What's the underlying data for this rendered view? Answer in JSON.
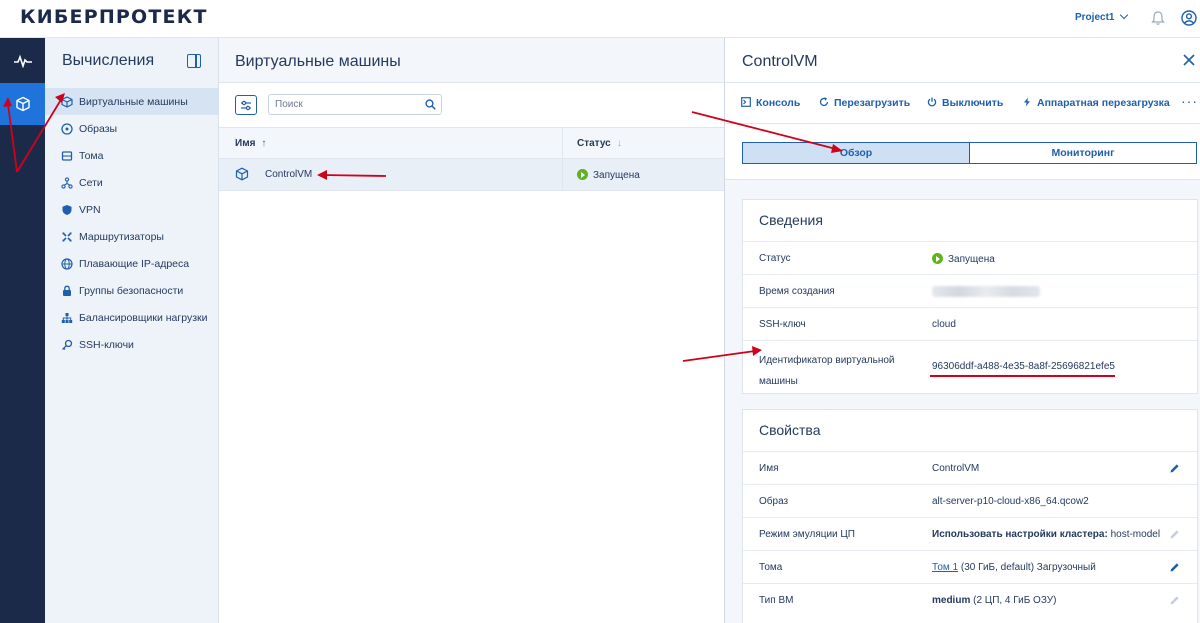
{
  "header": {
    "logo": "КИБЕРПРОТЕКТ",
    "project": "Project1"
  },
  "rail": {
    "items": [
      {
        "icon": "activity-icon"
      },
      {
        "icon": "cube-icon",
        "active": true
      }
    ]
  },
  "sidebar": {
    "title": "Вычисления",
    "items": [
      {
        "label": "Виртуальные машины",
        "icon": "cube-icon",
        "active": true
      },
      {
        "label": "Образы",
        "icon": "disc-icon"
      },
      {
        "label": "Тома",
        "icon": "volume-icon"
      },
      {
        "label": "Сети",
        "icon": "network-icon"
      },
      {
        "label": "VPN",
        "icon": "shield-icon"
      },
      {
        "label": "Маршрутизаторы",
        "icon": "router-icon"
      },
      {
        "label": "Плавающие IP-адреса",
        "icon": "globe-icon"
      },
      {
        "label": "Группы безопасности",
        "icon": "lock-icon"
      },
      {
        "label": "Балансировщики нагрузки",
        "icon": "balancer-icon"
      },
      {
        "label": "SSH-ключи",
        "icon": "key-icon"
      }
    ]
  },
  "main": {
    "title": "Виртуальные машины",
    "search_placeholder": "Поиск",
    "columns": {
      "name": "Имя",
      "name_sort": "↑",
      "status": "Статус",
      "status_sort": "↓"
    },
    "rows": [
      {
        "name": "ControlVM",
        "status": "Запущена"
      }
    ]
  },
  "panel": {
    "title": "ControlVM",
    "actions": [
      {
        "label": "Консоль",
        "icon": "console-icon"
      },
      {
        "label": "Перезагрузить",
        "icon": "restart-icon"
      },
      {
        "label": "Выключить",
        "icon": "power-icon"
      },
      {
        "label": "Аппаратная перезагрузка",
        "icon": "bolt-icon"
      }
    ],
    "more": "···",
    "tabs": [
      {
        "label": "Обзор",
        "active": true
      },
      {
        "label": "Мониторинг"
      }
    ],
    "info": {
      "title": "Сведения",
      "status_label": "Статус",
      "status_value": "Запущена",
      "created_label": "Время создания",
      "ssh_label": "SSH-ключ",
      "ssh_value": "cloud",
      "vmid_label_1": "Идентификатор виртуальной",
      "vmid_label_2": "машины",
      "vmid_value": "96306ddf-a488-4e35-8a8f-25696821efe5"
    },
    "props": {
      "title": "Свойства",
      "name_label": "Имя",
      "name_value": "ControlVM",
      "image_label": "Образ",
      "image_value": "alt-server-p10-cloud-x86_64.qcow2",
      "cpu_label": "Режим эмуляции ЦП",
      "cpu_value_bold": "Использовать настройки кластера:",
      "cpu_value": " host-model",
      "volumes_label": "Тома",
      "volumes_link": "Том 1",
      "volumes_value": " (30 ГиБ, default) Загрузочный",
      "type_label": "Тип ВМ",
      "type_value_bold": "medium",
      "type_value": " (2 ЦП, 4 ГиБ ОЗУ)"
    }
  },
  "colors": {
    "accent": "#1f5fae",
    "rail": "#1c2a4a",
    "rail_active": "#1f73db",
    "running": "#5fb322",
    "annotation": "#d0021b"
  }
}
